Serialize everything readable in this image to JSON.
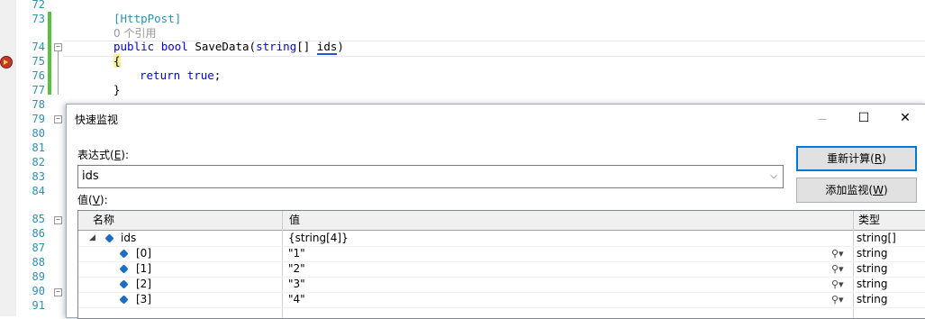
{
  "editor": {
    "line_numbers": [
      "72",
      "73",
      "74",
      "75",
      "76",
      "77",
      "78",
      "79",
      "80",
      "81",
      "82",
      "83",
      "84",
      "85",
      "86",
      "87",
      "88",
      "89",
      "90",
      "91"
    ],
    "line_attr": "[HttpPost]",
    "refs": "0 个引用",
    "signature": {
      "kw1": "public",
      "kw2": "bool",
      "name": " SaveData(",
      "kw3": "string",
      "mid": "[] ",
      "param": "ids",
      "end": ")"
    },
    "open_brace": "{",
    "return_kw": "return",
    "return_val": "true",
    "return_end": ";",
    "close_brace": "}"
  },
  "quickwatch": {
    "title": "快速监视",
    "minimize": "—",
    "maximize": "☐",
    "close": "✕",
    "expression_label": "表达式(",
    "expression_hotkey": "E",
    "expression_label_end": "):",
    "expression_value": "ids",
    "value_label": "值(",
    "value_hotkey": "V",
    "value_label_end": "):",
    "recalc_button": "重新计算(",
    "recalc_hotkey": "R",
    "recalc_end": ")",
    "addwatch_button": "添加监视(",
    "addwatch_hotkey": "W",
    "addwatch_end": ")",
    "grid": {
      "col_name": "名称",
      "col_value": "值",
      "col_type": "类型",
      "root": {
        "name": "ids",
        "value": "{string[4]}",
        "type": "string[]"
      },
      "rows": [
        {
          "name": "[0]",
          "value": "\"1\"",
          "type": "string"
        },
        {
          "name": "[1]",
          "value": "\"2\"",
          "type": "string"
        },
        {
          "name": "[2]",
          "value": "\"3\"",
          "type": "string"
        },
        {
          "name": "[3]",
          "value": "\"4\"",
          "type": "string"
        }
      ]
    }
  },
  "colors": {
    "line_number": "#2b91af",
    "keyword": "#0000ff",
    "change_bar": "#56c23d",
    "accent": "#0078d7"
  }
}
